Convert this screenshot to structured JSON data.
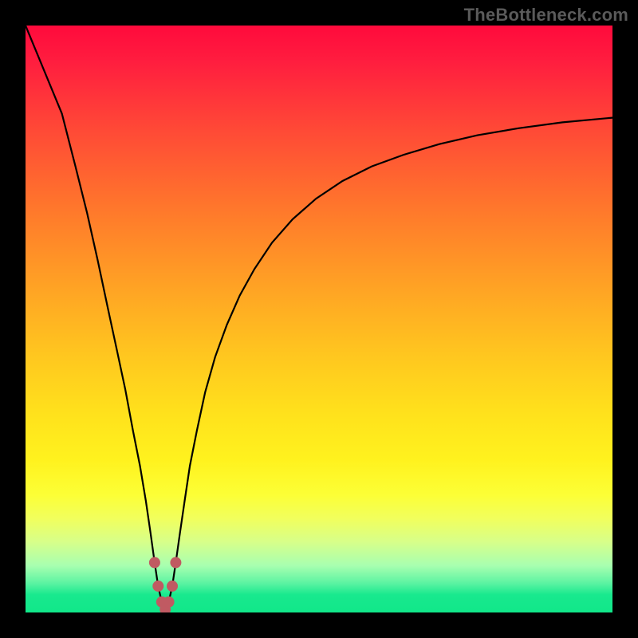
{
  "watermark": {
    "text": "TheBottleneck.com"
  },
  "colors": {
    "gradient_top": "#ff0a3c",
    "gradient_mid": "#ffe11c",
    "gradient_bottom": "#11e789",
    "curve_stroke": "#000000",
    "marker_fill": "#c05a62",
    "frame": "#000000"
  },
  "chart_data": {
    "type": "line",
    "title": "",
    "xlabel": "",
    "ylabel": "",
    "xlim": [
      0,
      100
    ],
    "ylim": [
      0,
      100
    ],
    "grid": false,
    "x": [
      0.0,
      6.2,
      8.5,
      10.5,
      12.3,
      14.0,
      15.5,
      17.0,
      18.3,
      19.5,
      20.5,
      21.3,
      22.0,
      22.6,
      23.2,
      23.8,
      24.4,
      25.0,
      25.6,
      26.3,
      27.1,
      28.0,
      29.2,
      30.6,
      32.3,
      34.3,
      36.5,
      39.0,
      42.0,
      45.5,
      49.5,
      54.0,
      59.0,
      64.5,
      70.5,
      77.0,
      84.0,
      91.5,
      100.0
    ],
    "values": [
      100.0,
      85.0,
      76.0,
      68.0,
      60.0,
      52.0,
      45.0,
      38.0,
      31.0,
      25.0,
      19.0,
      13.5,
      8.5,
      4.5,
      1.8,
      0.5,
      1.8,
      4.5,
      8.5,
      13.5,
      19.0,
      25.0,
      31.0,
      37.5,
      43.5,
      49.0,
      54.0,
      58.5,
      63.0,
      67.0,
      70.5,
      73.5,
      76.0,
      78.0,
      79.8,
      81.3,
      82.5,
      83.5,
      84.3
    ],
    "markers": {
      "x": [
        22.0,
        22.6,
        23.2,
        23.8,
        24.4,
        25.0,
        25.6
      ],
      "values": [
        8.5,
        4.5,
        1.8,
        0.5,
        1.8,
        4.5,
        8.5
      ]
    },
    "note": "U-shaped bottleneck curve. Values are read off the vertical gradient: y=0 at the green bottom, y=100 at the red top. Minimum (optimal match) is near x≈23-24 at y≈0-1. Curve is asymmetric: left branch rises steeply to 100, right branch rises to ~84."
  }
}
